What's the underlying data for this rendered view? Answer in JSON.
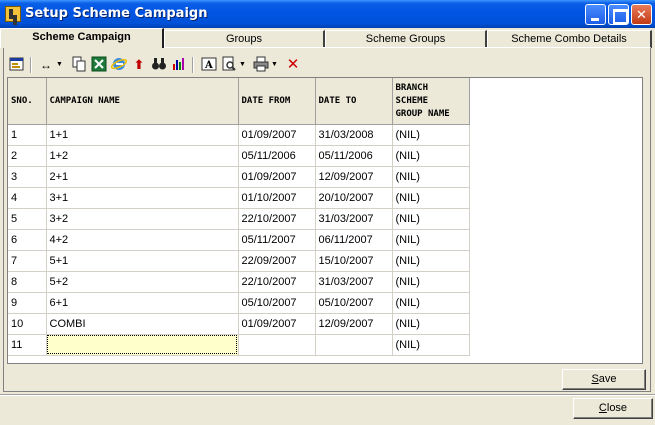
{
  "window": {
    "title": "Setup Scheme Campaign"
  },
  "tabs": [
    {
      "label": "Scheme Campaign",
      "active": true
    },
    {
      "label": "Groups",
      "active": false
    },
    {
      "label": "Scheme Groups",
      "active": false
    },
    {
      "label": "Scheme Combo Details",
      "active": false
    }
  ],
  "toolbar": {
    "icons": [
      "form-icon",
      "column-width-icon",
      "copy-icon",
      "excel-icon",
      "internet-explorer-icon",
      "up-arrow-icon",
      "binoculars-icon",
      "chart-icon",
      "font-icon",
      "print-preview-icon",
      "printer-icon",
      "delete-icon"
    ]
  },
  "grid": {
    "headers": {
      "sno": "SNO.",
      "name": "CAMPAIGN NAME",
      "from": "DATE FROM",
      "to": "DATE TO",
      "branch_line1": "BRANCH",
      "branch_line2": "SCHEME",
      "branch_line3": "GROUP NAME"
    },
    "rows": [
      {
        "sno": "1",
        "name": "1+1",
        "from": "01/09/2007",
        "to": "31/03/2008",
        "branch": "(NIL)"
      },
      {
        "sno": "2",
        "name": "1+2",
        "from": "05/11/2006",
        "to": "05/11/2006",
        "branch": "(NIL)"
      },
      {
        "sno": "3",
        "name": "2+1",
        "from": "01/09/2007",
        "to": "12/09/2007",
        "branch": "(NIL)"
      },
      {
        "sno": "4",
        "name": "3+1",
        "from": "01/10/2007",
        "to": "20/10/2007",
        "branch": "(NIL)"
      },
      {
        "sno": "5",
        "name": "3+2",
        "from": "22/10/2007",
        "to": "31/03/2007",
        "branch": "(NIL)"
      },
      {
        "sno": "6",
        "name": "4+2",
        "from": "05/11/2007",
        "to": "06/11/2007",
        "branch": "(NIL)"
      },
      {
        "sno": "7",
        "name": "5+1",
        "from": "22/09/2007",
        "to": "15/10/2007",
        "branch": "(NIL)"
      },
      {
        "sno": "8",
        "name": "5+2",
        "from": "22/10/2007",
        "to": "31/03/2007",
        "branch": "(NIL)"
      },
      {
        "sno": "9",
        "name": "6+1",
        "from": "05/10/2007",
        "to": "05/10/2007",
        "branch": "(NIL)"
      },
      {
        "sno": "10",
        "name": "COMBI",
        "from": "01/09/2007",
        "to": "12/09/2007",
        "branch": "(NIL)"
      },
      {
        "sno": "11",
        "name": "",
        "from": "",
        "to": "",
        "branch": "(NIL)"
      }
    ]
  },
  "buttons": {
    "save_hotkey": "S",
    "save_rest": "ave",
    "close_hotkey": "C",
    "close_rest": "lose"
  },
  "colors": {
    "titlebar": "#0055e5",
    "editing_cell": "#ffffcc",
    "delete_icon": "#cc0000"
  }
}
